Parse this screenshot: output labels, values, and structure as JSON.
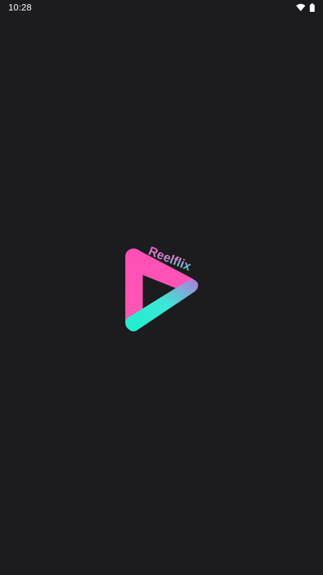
{
  "status_bar": {
    "time": "10:28",
    "icons": [
      "wifi-icon",
      "battery-icon"
    ]
  },
  "splash": {
    "brand_name": "Reelflix",
    "logo_icon": "play-triangle-logo-icon"
  },
  "colors": {
    "background": "#1c1c1e",
    "brand_pink": "#ff4fb7",
    "brand_teal": "#1af0d0",
    "text_white": "#ffffff"
  }
}
